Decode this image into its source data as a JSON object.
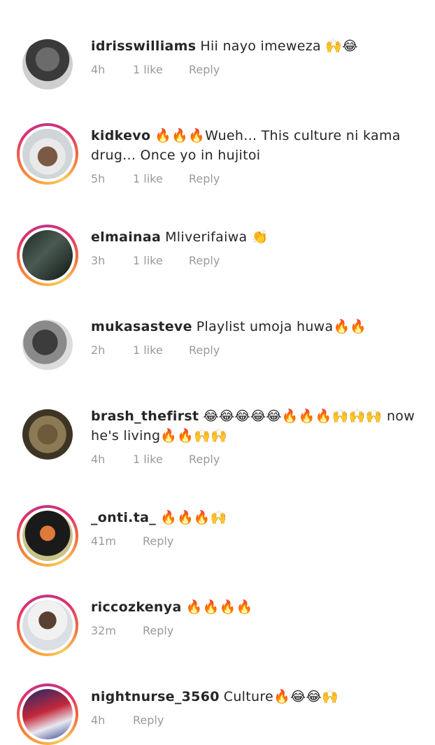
{
  "comments": [
    {
      "username": "idrisswilliams",
      "text": "Hii nayo imeweza 🙌😂",
      "time": "4h",
      "likes": "1 like",
      "reply": "Reply"
    },
    {
      "username": "kidkevo",
      "text": "🔥🔥🔥Wueh... This culture ni kama drug... Once yo in hujitoi",
      "time": "5h",
      "likes": "1 like",
      "reply": "Reply"
    },
    {
      "username": "elmainaa",
      "text": "Mliverifaiwa 👏",
      "time": "3h",
      "likes": "1 like",
      "reply": "Reply"
    },
    {
      "username": "mukasasteve",
      "text": "Playlist umoja huwa🔥🔥",
      "time": "2h",
      "likes": "1 like",
      "reply": "Reply"
    },
    {
      "username": "brash_thefirst",
      "text": "😂😂😂😂😂🔥🔥🔥🙌🙌🙌 now he's living🔥🔥🙌🙌",
      "time": "4h",
      "likes": "1 like",
      "reply": "Reply"
    },
    {
      "username": "_onti.ta_",
      "text": "🔥🔥🔥🙌",
      "time": "41m",
      "likes": "",
      "reply": "Reply"
    },
    {
      "username": "riccozkenya",
      "text": "🔥🔥🔥🔥",
      "time": "32m",
      "likes": "",
      "reply": "Reply"
    },
    {
      "username": "nightnurse_3560",
      "text": "Culture🔥😂😂🙌",
      "time": "4h",
      "likes": "",
      "reply": "Reply"
    }
  ],
  "icons": {
    "avatar": "profile-photo"
  },
  "colors": {
    "story_ring": "#e1306c",
    "meta_text": "#9a9a9a",
    "text": "#262626"
  }
}
